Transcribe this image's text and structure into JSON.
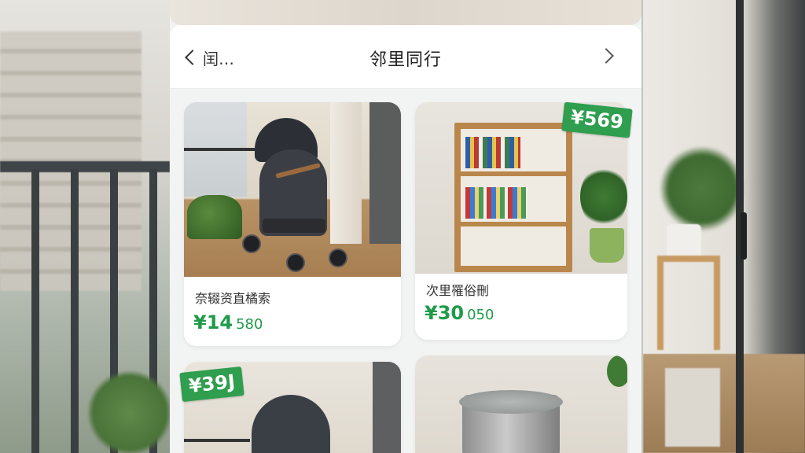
{
  "header": {
    "back_label": "闰…",
    "title": "邻里同行"
  },
  "cards": [
    {
      "name": "奈辍资直橘索",
      "price_main": "¥14",
      "price_sub": "580"
    },
    {
      "name": "次里罹俗刪",
      "price_main": "¥30",
      "price_sub": "050",
      "tag": "¥569"
    },
    {
      "tag": "¥39J"
    }
  ],
  "colors": {
    "price_green": "#1e9b4a",
    "tag_green": "#2f9e4f"
  }
}
